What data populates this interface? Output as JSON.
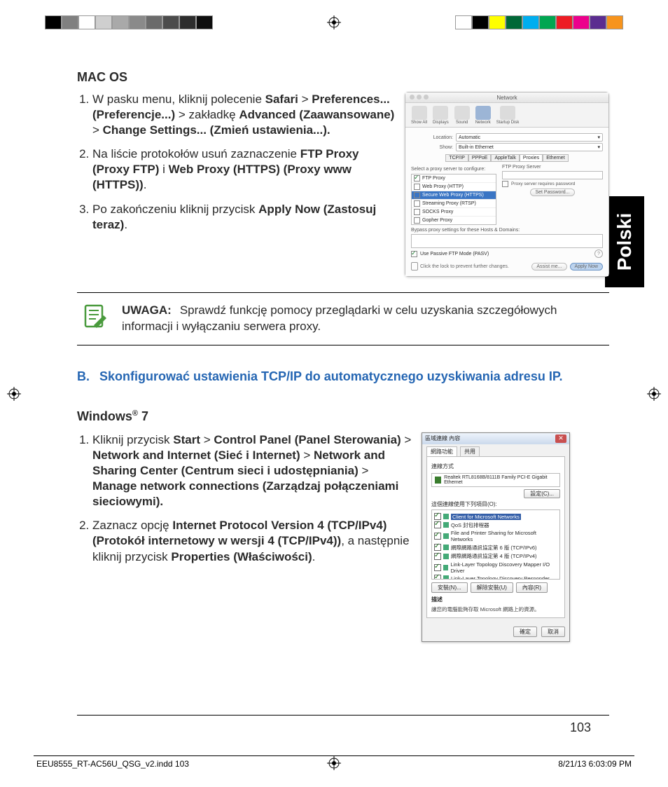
{
  "sideTab": "Polski",
  "pageNumber": "103",
  "footer": {
    "file": "EEU8555_RT-AC56U_QSG_v2.indd   103",
    "timestamp": "8/21/13   6:03:09 PM"
  },
  "colorbar_left": [
    "#000000",
    "#808080",
    "#ffffff",
    "#cfcfcf",
    "#a9a9a9",
    "#8a8a8a",
    "#6b6b6b",
    "#4c4c4c",
    "#2d2d2d",
    "#0e0e0e"
  ],
  "colorbar_right": [
    "#ffffff",
    "#000000",
    "#ffff00",
    "#006837",
    "#00aeef",
    "#00a651",
    "#ed1c24",
    "#ec008c",
    "#5b2d90",
    "#f7941d"
  ],
  "sectionMac": {
    "heading": "MAC OS",
    "steps": [
      {
        "parts": [
          {
            "t": "W pasku menu, kliknij polecenie ",
            "b": false
          },
          {
            "t": "Safari",
            "b": true
          },
          {
            "t": " > ",
            "b": false
          },
          {
            "t": "Preferences... (Preferencje...)",
            "b": true
          },
          {
            "t": " > zakładkę ",
            "b": false
          },
          {
            "t": "Advanced (Zaawansowane)",
            "b": true
          },
          {
            "t": " > ",
            "b": false
          },
          {
            "t": "Change  Settings... (Zmień ustawienia...).",
            "b": true
          }
        ]
      },
      {
        "parts": [
          {
            "t": "Na liście protokołów usuń zaznaczenie ",
            "b": false
          },
          {
            "t": "FTP Proxy (Proxy FTP)",
            "b": true
          },
          {
            "t": " i ",
            "b": false
          },
          {
            "t": "Web Proxy (HTTPS) (Proxy www (HTTPS))",
            "b": true
          },
          {
            "t": ".",
            "b": false
          }
        ]
      },
      {
        "parts": [
          {
            "t": "Po zakończeniu kliknij przycisk  ",
            "b": false
          },
          {
            "t": "Apply Now (Zastosuj teraz)",
            "b": true
          },
          {
            "t": ".",
            "b": false
          }
        ]
      }
    ]
  },
  "macWindow": {
    "title": "Network",
    "toolbar": [
      "Show All",
      "Displays",
      "Sound",
      "Network",
      "Startup Disk"
    ],
    "locationLabel": "Location:",
    "locationValue": "Automatic",
    "showLabel": "Show:",
    "showValue": "Built-in Ethernet",
    "tabs": [
      "TCP/IP",
      "PPPoE",
      "AppleTalk",
      "Proxies",
      "Ethernet"
    ],
    "subhead": "Select a proxy server to configure:",
    "rightLabel": "FTP Proxy Server",
    "passwdChk": "Proxy server requires password",
    "setPwd": "Set Password...",
    "proxies": [
      {
        "label": "FTP Proxy",
        "checked": true
      },
      {
        "label": "Web Proxy (HTTP)",
        "checked": false
      },
      {
        "label": "Secure Web Proxy (HTTPS)",
        "checked": false,
        "hilite": true
      },
      {
        "label": "Streaming Proxy (RTSP)",
        "checked": false
      },
      {
        "label": "SOCKS Proxy",
        "checked": false
      },
      {
        "label": "Gopher Proxy",
        "checked": false
      }
    ],
    "bypass": "Bypass proxy settings for these Hosts & Domains:",
    "pasv": "Use Passive FTP Mode (PASV)",
    "lockText": "Click the lock to prevent further changes.",
    "assist": "Assist me...",
    "apply": "Apply Now"
  },
  "note": {
    "lead": "UWAGA:",
    "body": "Sprawdź funkcję pomocy przeglądarki w celu uzyskania szczegółowych informacji i wyłączaniu serwera proxy."
  },
  "sectionB": {
    "letter": "B.",
    "title": "Skonfigurować ustawienia TCP/IP do automatycznego uzyskiwania adresu IP."
  },
  "sectionWin": {
    "heading": "Windows® 7",
    "steps": [
      {
        "parts": [
          {
            "t": "Kliknij przycisk ",
            "b": false
          },
          {
            "t": "Start",
            "b": true
          },
          {
            "t": " > ",
            "b": false
          },
          {
            "t": "Control Panel (Panel Sterowania)",
            "b": true
          },
          {
            "t": " > ",
            "b": false
          },
          {
            "t": "Network and Internet (Sieć i Internet)",
            "b": true
          },
          {
            "t": " > ",
            "b": false
          },
          {
            "t": "Network and Sharing Center (Centrum sieci i udostępniania)",
            "b": true
          },
          {
            "t": " > ",
            "b": false
          },
          {
            "t": "Manage network connections (Zarządzaj połączeniami sieciowymi).",
            "b": true
          }
        ]
      },
      {
        "parts": [
          {
            "t": "Zaznacz opcję ",
            "b": false
          },
          {
            "t": "Internet Protocol Version 4 (TCP/IPv4) (Protokół internetowy w wersji 4 (TCP/IPv4))",
            "b": true
          },
          {
            "t": ", a następnie kliknij przycisk ",
            "b": false
          },
          {
            "t": "Properties (Właściwości)",
            "b": true
          },
          {
            "t": ".",
            "b": false
          }
        ]
      }
    ]
  },
  "winWindow": {
    "title": "區域連線 內容",
    "tabs": [
      "網路功能",
      "共用"
    ],
    "connectUsing": "連線方式",
    "adapter": "Realtek RTL8168B/8111B Family PCI-E Gigabit Ethernet",
    "config": "設定(C)...",
    "itemsLabel": "這個連線使用下列項目(O):",
    "items": [
      {
        "label": "Client for Microsoft Networks",
        "checked": true,
        "hl": true
      },
      {
        "label": "QoS 封包排程器",
        "checked": true
      },
      {
        "label": "File and Printer Sharing for Microsoft Networks",
        "checked": true
      },
      {
        "label": "網際網路通訊協定第 6 版 (TCP/IPv6)",
        "checked": true
      },
      {
        "label": "網際網路通訊協定第 4 版 (TCP/IPv4)",
        "checked": true
      },
      {
        "label": "Link-Layer Topology Discovery Mapper I/O Driver",
        "checked": true
      },
      {
        "label": "Link-Layer Topology Discovery Responder",
        "checked": true
      }
    ],
    "btnInstall": "安裝(N)...",
    "btnUninstall": "解除安裝(U)",
    "btnProps": "內容(R)",
    "descLabel": "描述",
    "desc": "讓您的電腦能夠存取 Microsoft 網路上的資源。",
    "ok": "確定",
    "cancel": "取消"
  }
}
